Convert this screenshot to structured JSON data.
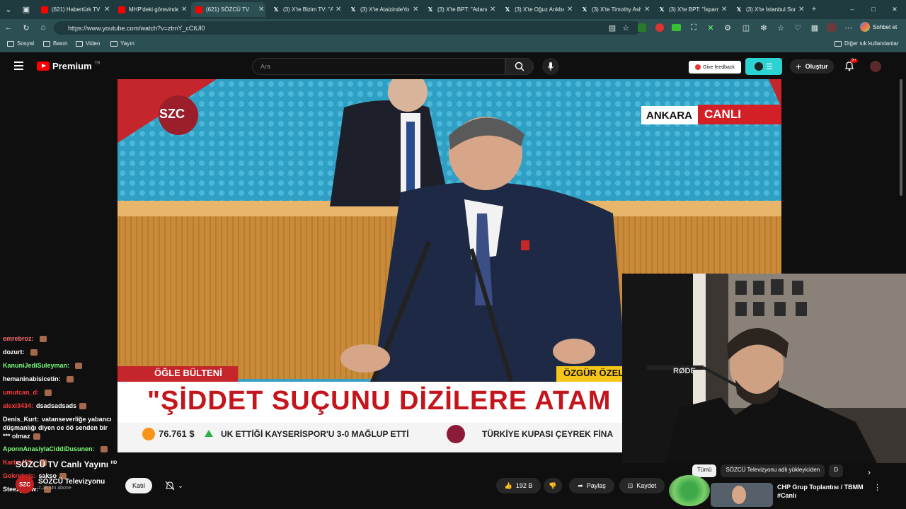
{
  "browser": {
    "tabs": [
      {
        "title": "(621) Habertürk TV",
        "icon": "youtube-icon",
        "active": false
      },
      {
        "title": "MHP'deki görevinde",
        "icon": "youtube-icon",
        "active": false
      },
      {
        "title": "(621) SÖZCÜ TV",
        "icon": "youtube-icon",
        "active": true
      },
      {
        "title": "(3) X'te Bizim TV: \"A",
        "icon": "x-icon",
        "active": false
      },
      {
        "title": "(3) X'te AtaizindeYo",
        "icon": "x-icon",
        "active": false
      },
      {
        "title": "(3) X'te BPT: \"Adana",
        "icon": "x-icon",
        "active": false
      },
      {
        "title": "(3) X'te Oğuz Arıkba",
        "icon": "x-icon",
        "active": false
      },
      {
        "title": "(3) X'te Timothy Ash",
        "icon": "x-icon",
        "active": false
      },
      {
        "title": "(3) X'te BPT: \"İspanya",
        "icon": "x-icon",
        "active": false
      },
      {
        "title": "(3) X'te İstanbul Son",
        "icon": "x-icon",
        "active": false
      }
    ],
    "url": "https://www.youtube.com/watch?v=ztmY_cCtUl0",
    "chat_button": "Sohbet et",
    "bookmarks": [
      "Sosyal",
      "Basın",
      "Video",
      "Yayın"
    ],
    "other_bookmarks": "Diğer sık kullanılanlar"
  },
  "header": {
    "logo": "Premium",
    "logo_sup": "TR",
    "search_placeholder": "Ara",
    "feedback": "Give feedback",
    "create": "Oluştur",
    "notification_badge": "9+"
  },
  "video": {
    "channel_logo": "SZC",
    "location": "ANKARA",
    "live": "CANLI",
    "segment": "ÖĞLE BÜLTENİ",
    "speaker": "ÖZGÜR ÖZEL",
    "headline": "\"ŞİDDET SUÇUNU DİZİLERE ATAM",
    "ticker_price": "76.761 $",
    "ticker_text_1": "UK ETTİĞİ KAYSERİSPOR'U 3-0 MAĞLUP ETTİ",
    "ticker_text_2": "TÜRKİYE KUPASI ÇEYREK FİNA",
    "podium_brand": "RØDE"
  },
  "chat": [
    {
      "user": "emrebroz:",
      "msg": "",
      "color": "#ff6b6b"
    },
    {
      "user": "dozurt:",
      "msg": "",
      "color": "#ffffff"
    },
    {
      "user": "KanuniJediSuleyman:",
      "msg": "",
      "color": "#7cfc7c"
    },
    {
      "user": "hemaninabisicetin:",
      "msg": "",
      "color": "#ffffff"
    },
    {
      "user": "umutcan_d:",
      "msg": "",
      "color": "#ff3b3b"
    },
    {
      "user": "alexi3434:",
      "msg": "dsadsadsads",
      "color": "#ff3b3b"
    },
    {
      "user": "Denis_Kurt:",
      "msg": "vatanseverliğe yabancı düşmanlığı diyen oe öö senden bir *** olmaz",
      "color": "#ffffff"
    },
    {
      "user": "AponnAnasiylaCiddiDusunen:",
      "msg": "",
      "color": "#7cfc7c"
    },
    {
      "user": "Karboz23:",
      "msg": "",
      "color": "#ff3b3b"
    },
    {
      "user": "Gokreksis:",
      "msg": "sakso",
      "color": "#ff3b3b"
    },
    {
      "user": "SteezyDew:",
      "msg": "",
      "color": "#ffffff"
    }
  ],
  "below": {
    "title": "SÖZCÜ TV Canlı Yayını",
    "hd": "HD",
    "channel_name": "SÖZCÜ Televizyonu",
    "subscribers": "2,26 Mn abone",
    "join": "Katıl",
    "likes": "192 B",
    "share": "Paylaş",
    "save": "Kaydet"
  },
  "related": {
    "chips": [
      "Tümü",
      "SÖZCÜ Televizyonu adlı yükleyiciden",
      "D"
    ],
    "video_title": "CHP Grup Toplantısı / TBMM #Canlı"
  }
}
